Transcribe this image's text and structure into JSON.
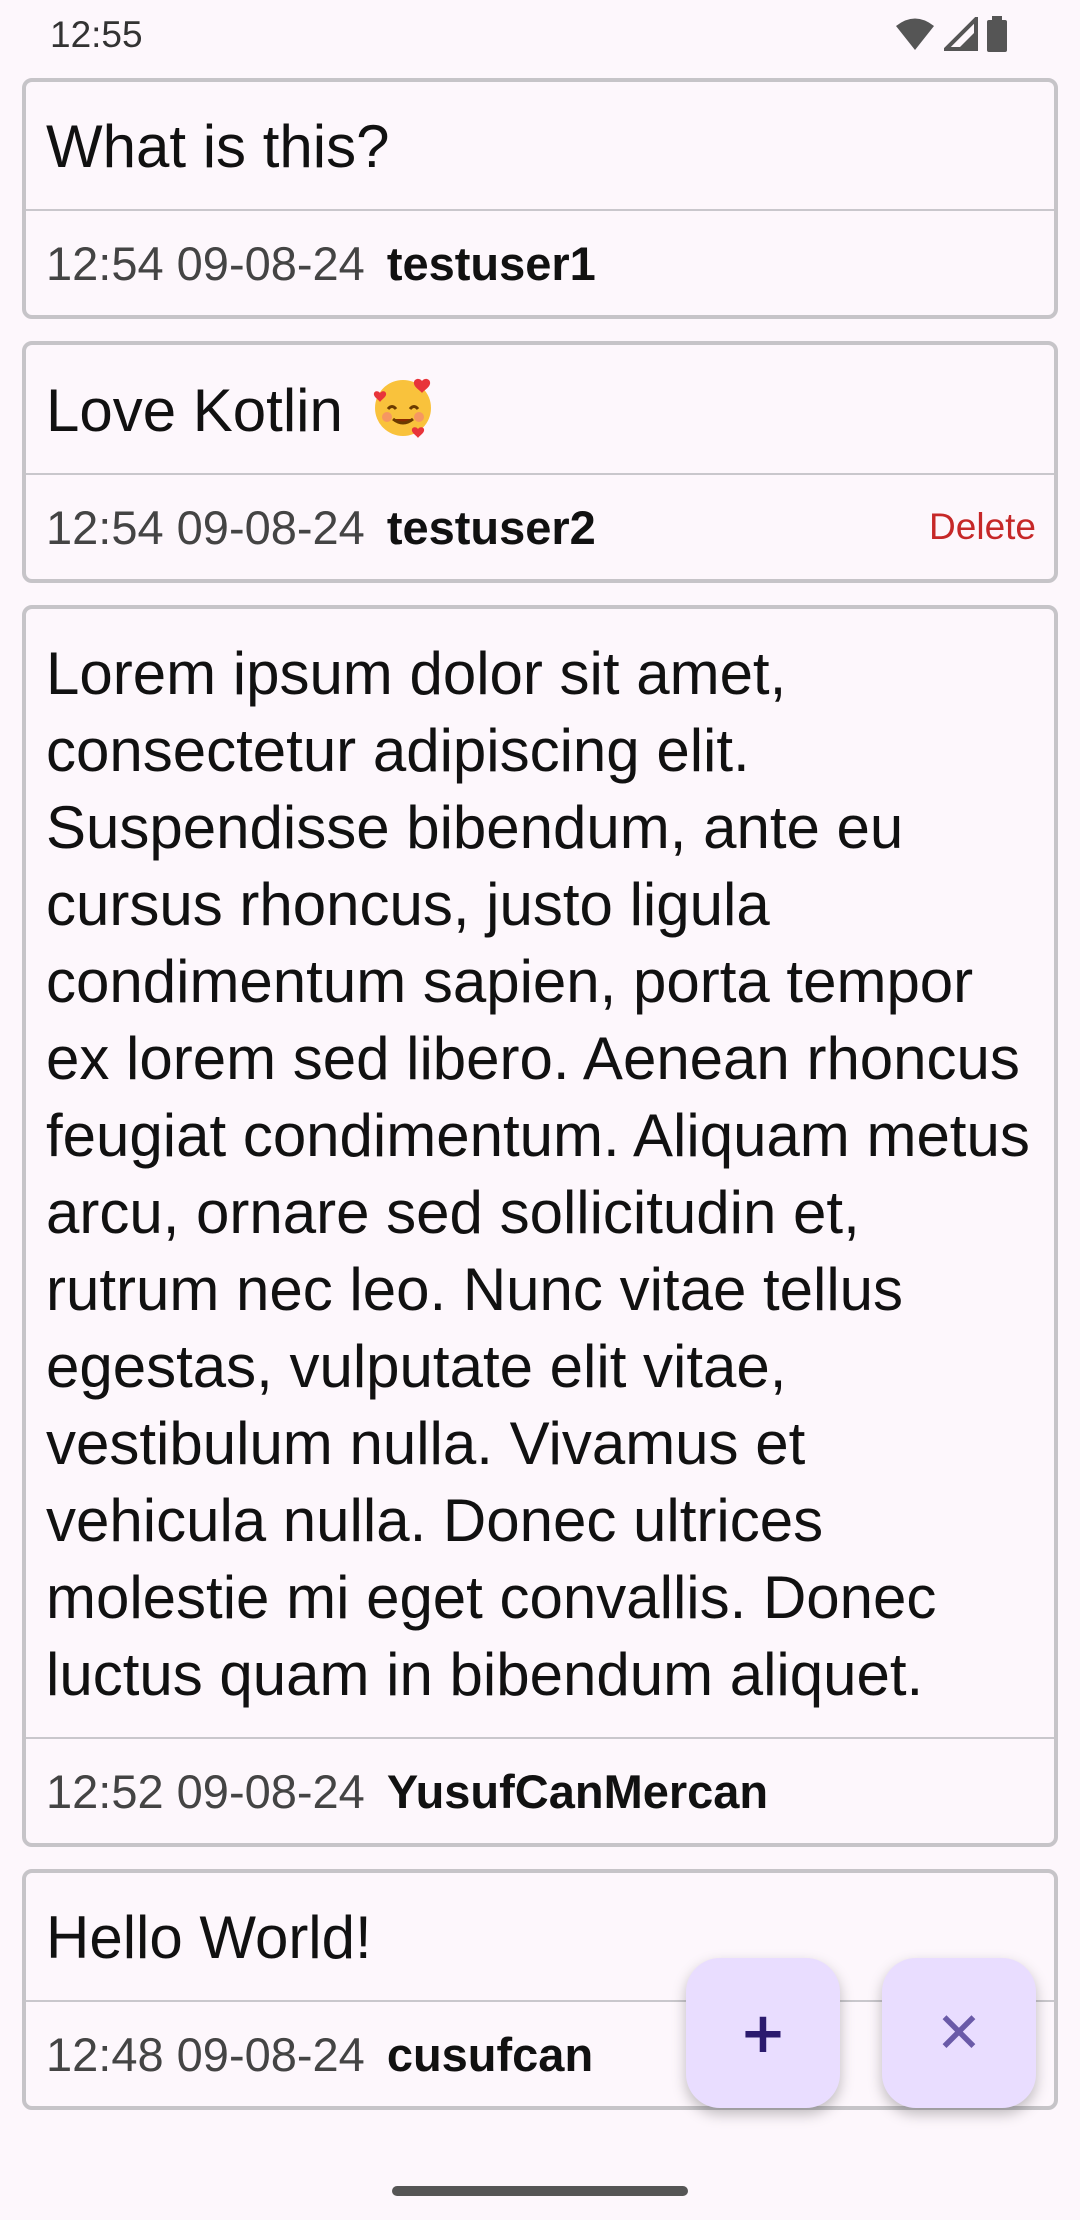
{
  "status_bar": {
    "time": "12:55",
    "icons": [
      "wifi-icon",
      "signal-icon",
      "battery-icon"
    ]
  },
  "posts": [
    {
      "text": "What is this?",
      "time": "12:54 09-08-24",
      "user": "testuser1"
    },
    {
      "text": "Love Kotlin",
      "emoji": "smiling-face-with-hearts-icon",
      "time": "12:54 09-08-24",
      "user": "testuser2",
      "delete_label": "Delete"
    },
    {
      "text": "Lorem ipsum dolor sit amet, consectetur adipiscing elit. Suspendisse bibendum, ante eu cursus rhoncus, justo ligula condimentum sapien, porta tempor ex lorem sed libero. Aenean rhoncus feugiat condimentum. Aliquam metus arcu, ornare sed sollicitudin et, rutrum nec leo. Nunc vitae tellus egestas, vulputate elit vitae, vestibulum nulla. Vivamus et vehicula nulla. Donec ultrices molestie mi eget convallis. Donec luctus quam in bibendum aliquet.",
      "time": "12:52 09-08-24",
      "user": "YusufCanMercan"
    },
    {
      "text": "Hello World!",
      "time": "12:48 09-08-24",
      "user": "cusufcan"
    }
  ],
  "fab": {
    "add_label": "+",
    "close_label": "✕"
  },
  "colors": {
    "background": "#fdf7fc",
    "card_border": "#c6c4c8",
    "delete": "#c62828",
    "fab_bg": "#e9ddff"
  }
}
